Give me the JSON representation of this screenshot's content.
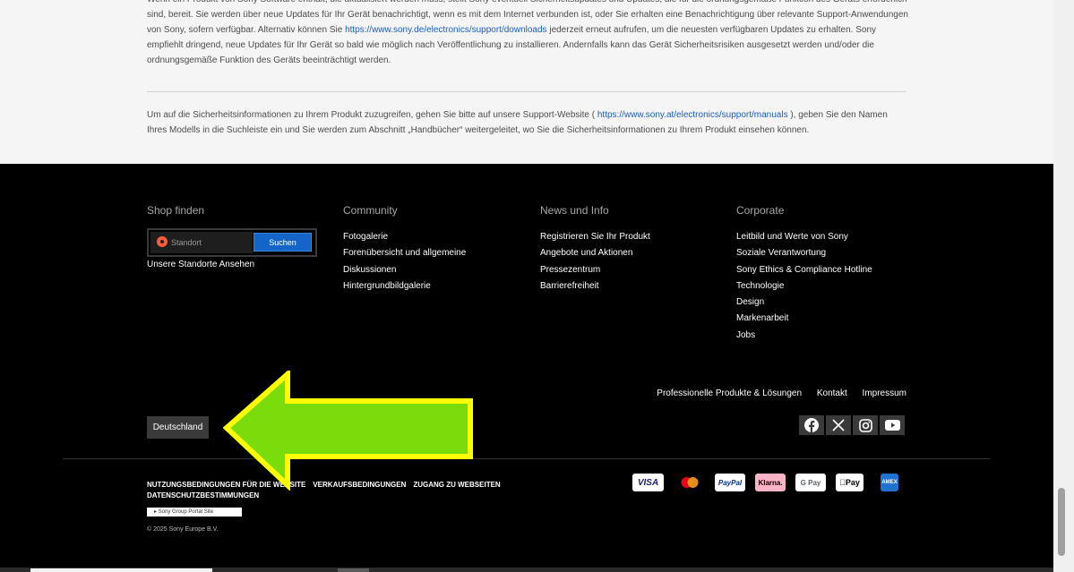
{
  "article": {
    "p1_a": "Wenn ein Produkt von Sony Software enthält, die aktualisiert werden muss, stellt Sony eventuell Sicherheitsupdates und Updates, die für die ordnungsgemäße Funktion des Geräts erforderlich sind, bereit. Sie werden über neue Updates für Ihr Gerät benachrichtigt, wenn es mit dem Internet verbunden ist, oder Sie erhalten eine Benachrichtigung über relevante Support-Anwendungen von Sony, sofern verfügbar. Alternativ können Sie ",
    "p1_link": "https://www.sony.de/electronics/support/downloads",
    "p1_b": " jederzeit erneut aufrufen, um die neuesten verfügbaren Updates zu erhalten. Sony empfiehlt dringend, neue Updates für Ihr Gerät so bald wie möglich nach Veröffentlichung zu installieren. Andernfalls kann das Gerät Sicherheitsrisiken ausgesetzt werden und/oder die ordnungsgemäße Funktion des Geräts beeinträchtigt werden.",
    "p2_a": "Um auf die Sicherheitsinformationen zu Ihrem Produkt zuzugreifen, gehen Sie bitte auf unsere Support-Website ( ",
    "p2_link": "https://www.sony.at/electronics/support/manuals",
    "p2_b": " ), geben Sie den Namen Ihres Modells in die Suchleiste ein und Sie werden zum Abschnitt „Handbücher“ weitergeleitet, wo Sie die Sicherheitsinformationen zu Ihrem Produkt einsehen können."
  },
  "footer": {
    "shop": {
      "title": "Shop finden",
      "placeholder": "Standort",
      "search_label": "Suchen",
      "stores_link": "Unsere Standorte Ansehen"
    },
    "community": {
      "title": "Community",
      "items": [
        "Fotogalerie",
        "Forenübersicht und allgemeine Diskussionen",
        "Hintergrundbildgalerie"
      ]
    },
    "news": {
      "title": "News und Info",
      "items": [
        "Registrieren Sie Ihr Produkt",
        "Angebote und Aktionen",
        "Pressezentrum",
        "Barrierefreiheit"
      ]
    },
    "corporate": {
      "title": "Corporate",
      "items": [
        "Leitbild und Werte von Sony",
        "Soziale Verantwortung",
        "Sony Ethics & Compliance Hotline",
        "Technologie",
        "Design",
        "Markenarbeit",
        "Jobs"
      ]
    },
    "util_links": [
      "Professionelle Produkte & Lösungen",
      "Kontakt",
      "Impressum"
    ],
    "country": "Deutschland",
    "social_icons": [
      "facebook-icon",
      "x-icon",
      "instagram-icon",
      "youtube-icon"
    ],
    "legal": [
      "NUTZUNGSBEDINGUNGEN FÜR DIE WEBSITE",
      "VERKAUFSBEDINGUNGEN",
      "ZUGANG ZU WEBSEITEN",
      "DATENSCHUTZBESTIMMUNGEN"
    ],
    "portal": "▸ Sony Group Portal Site",
    "copyright": "© 2025 Sony Europe B.V.",
    "payments": {
      "visa": "VISA",
      "paypal": "PayPal",
      "klarna": "Klarna.",
      "gpay": "G Pay",
      "apay": "Pay",
      "amex": "AMEX"
    }
  },
  "colors": {
    "footer_bg": "#000000",
    "link_blue": "#1a5dc4",
    "search_button": "#1565c8",
    "arrow_fill": "#7bdc0b",
    "arrow_stroke": "#ffff00"
  }
}
